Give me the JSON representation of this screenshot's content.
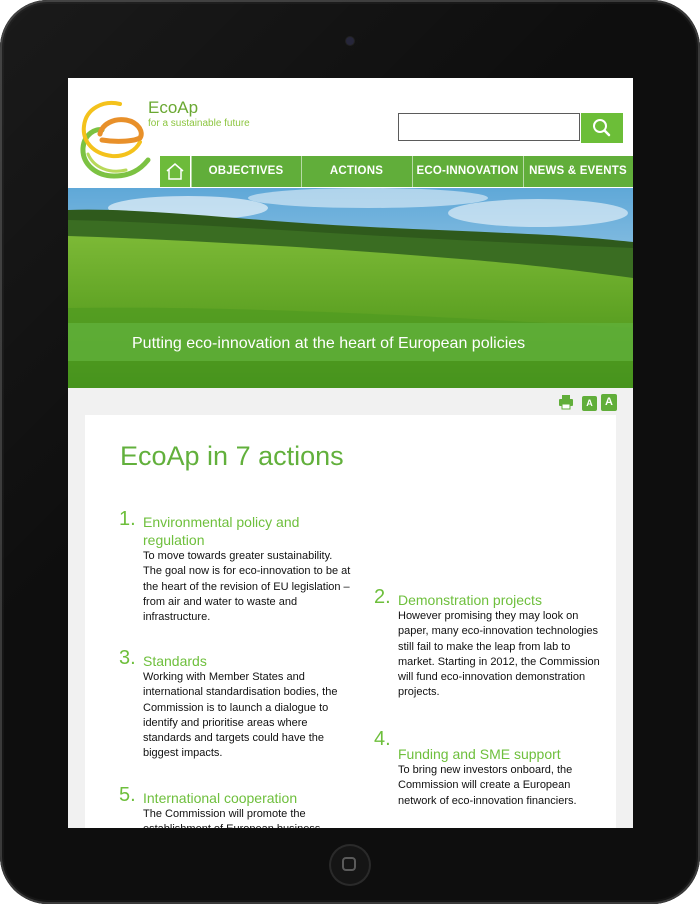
{
  "site": {
    "brand_name": "EcoAp",
    "tagline": "for a sustainable future"
  },
  "search": {
    "placeholder": "",
    "button_icon": "search-icon"
  },
  "nav": {
    "home_icon": "home-icon",
    "items": [
      {
        "label": "OBJECTIVES"
      },
      {
        "label": "ACTIONS"
      },
      {
        "label": "ECO-INNOVATION"
      },
      {
        "label": "NEWS & EVENTS"
      }
    ]
  },
  "hero": {
    "caption": "Putting eco-innovation at the heart of European policies"
  },
  "tools": {
    "print_icon": "print-icon",
    "font_small": "A",
    "font_large": "A"
  },
  "main": {
    "title": "EcoAp in 7 actions",
    "actions": [
      {
        "number": "1.",
        "title": "Environmental policy and regulation",
        "description": "To move towards greater sustainability. The goal now is for eco-innovation to be at the heart of the revision of EU legislation – from air and water to waste and infrastructure."
      },
      {
        "number": "2.",
        "title": "Demonstration projects",
        "description": "However promising they may look on paper, many eco-innovation technologies still fail to make the leap from lab to market. Starting in 2012, the Commission will fund eco-innovation demonstration projects."
      },
      {
        "number": "3.",
        "title": "Standards",
        "description": "Working with Member States and international standardisation bodies, the Commission is to launch a dialogue to identify and prioritise areas where standards and targets could have the biggest impacts."
      },
      {
        "number": "4.",
        "title": "Funding and SME support",
        "description": "To bring new investors onboard, the Commission will create a European network of eco-innovation financiers."
      },
      {
        "number": "5.",
        "title": "International cooperation",
        "description": "The Commission will promote the establishment of European business"
      }
    ]
  },
  "colors": {
    "brand_green": "#61ae3a",
    "accent_green": "#6ebf3c",
    "bezel": "#0e0e0e"
  }
}
